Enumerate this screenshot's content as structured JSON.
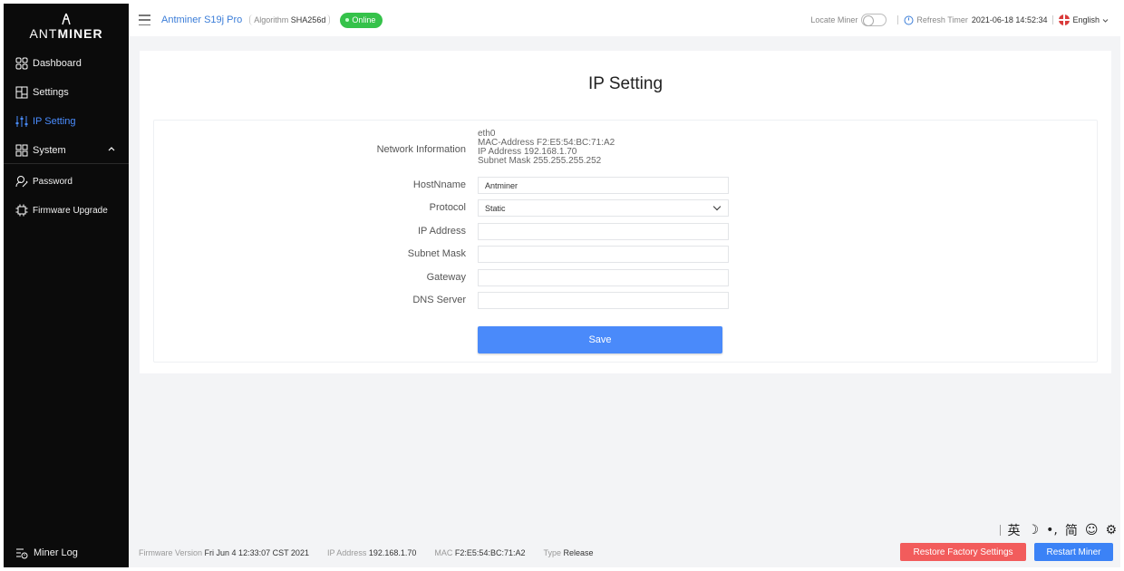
{
  "brand": {
    "logo_text_a": "ANT",
    "logo_text_b": "MINER"
  },
  "sidebar": {
    "items": [
      {
        "label": "Dashboard",
        "icon": "dashboard-icon"
      },
      {
        "label": "Settings",
        "icon": "settings-icon"
      },
      {
        "label": "IP Setting",
        "icon": "ip-setting-icon",
        "active": true
      },
      {
        "label": "System",
        "icon": "system-icon",
        "expanded": true
      },
      {
        "label": "Password",
        "icon": "password-icon"
      },
      {
        "label": "Firmware Upgrade",
        "icon": "firmware-icon"
      }
    ],
    "bottom": {
      "label": "Miner Log",
      "icon": "miner-log-icon"
    }
  },
  "header": {
    "model": "Antminer S19j Pro",
    "algorithm_label": "Algorithm",
    "algorithm_value": "SHA256d",
    "status": "Online",
    "locate_label": "Locate Miner",
    "refresh_label": "Refresh Timer",
    "refresh_time": "2021-06-18 14:52:34",
    "language": "English"
  },
  "page": {
    "title": "IP Setting"
  },
  "form": {
    "network_information_label": "Network Information",
    "network_info": {
      "interface": "eth0",
      "mac": "MAC-Address F2:E5:54:BC:71:A2",
      "ip": "IP Address 192.168.1.70",
      "subnet": "Subnet Mask 255.255.255.252"
    },
    "hostname_label": "HostNname",
    "hostname_value": "Antminer",
    "protocol_label": "Protocol",
    "protocol_value": "Static",
    "ip_address_label": "IP Address",
    "ip_address_value": "",
    "subnet_mask_label": "Subnet Mask",
    "subnet_mask_value": "",
    "gateway_label": "Gateway",
    "gateway_value": "",
    "dns_server_label": "DNS Server",
    "dns_server_value": "",
    "save_label": "Save"
  },
  "ime": {
    "items": [
      "英",
      "☽",
      "•,",
      "简",
      "☺",
      "⚙"
    ]
  },
  "footer": {
    "firmware_label": "Firmware Version",
    "firmware_value": "Fri Jun 4 12:33:07 CST 2021",
    "ip_label": "IP Address",
    "ip_value": "192.168.1.70",
    "mac_label": "MAC",
    "mac_value": "F2:E5:54:BC:71:A2",
    "type_label": "Type",
    "type_value": "Release",
    "restore_label": "Restore Factory Settings",
    "restart_label": "Restart Miner"
  },
  "colors": {
    "sidebar_bg": "#0b0b0b",
    "accent": "#4a8afa",
    "online": "#35c24a",
    "danger": "#f25c5c",
    "background": "#f3f4f6"
  }
}
